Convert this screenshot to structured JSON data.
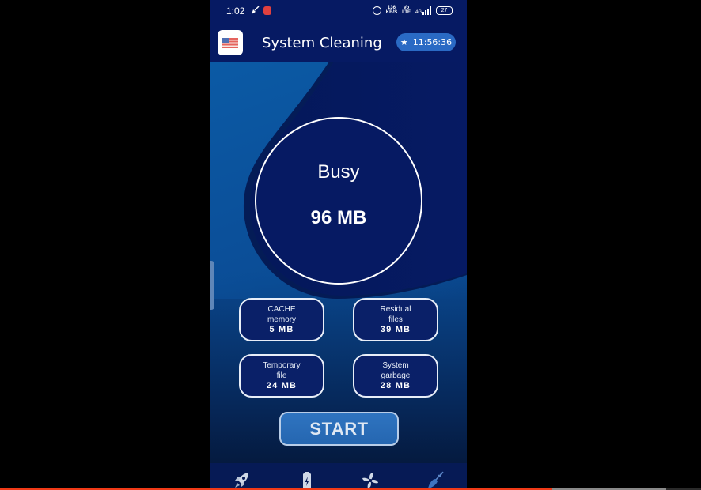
{
  "status_bar": {
    "time": "1:02",
    "network_speed_value": "136",
    "network_speed_unit": "KB/S",
    "volte_top": "Vo",
    "volte_bottom": "LTE",
    "signal_label": "4G",
    "battery": "27",
    "icons": [
      "cleaner-notification-icon",
      "red-app-notification-icon",
      "alarm-icon",
      "network-speed-icon",
      "volte-icon",
      "signal-icon",
      "battery-icon"
    ]
  },
  "app_bar": {
    "logo_icon": "us-flag-icon",
    "title": "System Cleaning",
    "timer_icon": "star-icon",
    "timer": "11:56:36"
  },
  "summary": {
    "status": "Busy",
    "value": "96 MB"
  },
  "stats": [
    {
      "line1": "CACHE",
      "line2": "memory",
      "value": "5 MB"
    },
    {
      "line1": "Residual",
      "line2": "files",
      "value": "39 MB"
    },
    {
      "line1": "Temporary",
      "line2": "file",
      "value": "24 MB"
    },
    {
      "line1": "System",
      "line2": "garbage",
      "value": "28 MB"
    }
  ],
  "start_button": {
    "label": "START"
  },
  "bottom_nav": {
    "items": [
      {
        "icon": "rocket-icon",
        "name": "boost",
        "active": false
      },
      {
        "icon": "battery-icon",
        "name": "battery",
        "active": false
      },
      {
        "icon": "fan-icon",
        "name": "cooler",
        "active": false
      },
      {
        "icon": "broom-icon",
        "name": "clean",
        "active": true
      }
    ]
  },
  "video_progress": {
    "played_fraction": 0.788,
    "buffered_fraction": 0.95
  },
  "colors": {
    "primary_dark": "#061a63",
    "accent_blue": "#2a6ac4",
    "progress_red": "#f03a17"
  }
}
